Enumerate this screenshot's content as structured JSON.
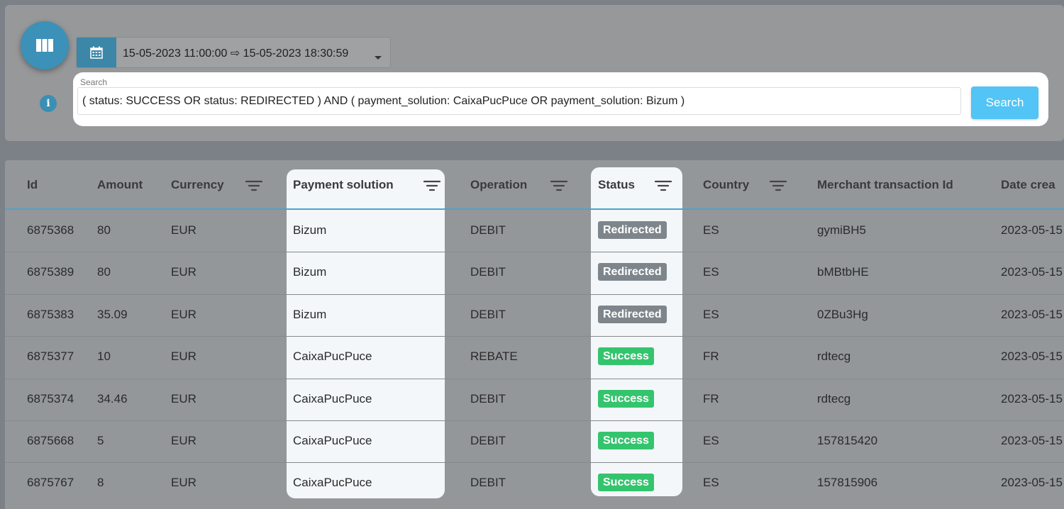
{
  "date_range": {
    "value": "15-05-2023 11:00:00 ⇨ 15-05-2023 18:30:59"
  },
  "search": {
    "label": "Search",
    "value": "( status: SUCCESS OR status: REDIRECTED ) AND ( payment_solution: CaixaPucPuce OR payment_solution: Bizum )",
    "button_label": "Search"
  },
  "icons": {
    "fab": "columns-icon",
    "calendar": "calendar-icon",
    "info": "info-icon",
    "info_glyph": "i",
    "filter": "filter-icon"
  },
  "colors": {
    "accent": "#3b91b8",
    "search_button": "#52c4f5",
    "badge_redirected": "#7e868c",
    "badge_success": "#34c46e",
    "header_line": "#4aa3cf"
  },
  "table": {
    "columns": [
      {
        "key": "id",
        "label": "Id",
        "filter": false
      },
      {
        "key": "amount",
        "label": "Amount",
        "filter": false
      },
      {
        "key": "currency",
        "label": "Currency",
        "filter": true
      },
      {
        "key": "payment_solution",
        "label": "Payment solution",
        "filter": true
      },
      {
        "key": "operation",
        "label": "Operation",
        "filter": true
      },
      {
        "key": "status",
        "label": "Status",
        "filter": true
      },
      {
        "key": "country",
        "label": "Country",
        "filter": true
      },
      {
        "key": "merchant_tx",
        "label": "Merchant transaction Id",
        "filter": false
      },
      {
        "key": "date",
        "label": "Date crea",
        "filter": false
      }
    ],
    "rows": [
      {
        "id": "6875368",
        "amount": "80",
        "currency": "EUR",
        "payment_solution": "Bizum",
        "operation": "DEBIT",
        "status": "Redirected",
        "status_type": "redirected",
        "country": "ES",
        "merchant_tx": "gymiBH5",
        "date": "2023-05-15"
      },
      {
        "id": "6875389",
        "amount": "80",
        "currency": "EUR",
        "payment_solution": "Bizum",
        "operation": "DEBIT",
        "status": "Redirected",
        "status_type": "redirected",
        "country": "ES",
        "merchant_tx": "bMBtbHE",
        "date": "2023-05-15"
      },
      {
        "id": "6875383",
        "amount": "35.09",
        "currency": "EUR",
        "payment_solution": "Bizum",
        "operation": "DEBIT",
        "status": "Redirected",
        "status_type": "redirected",
        "country": "ES",
        "merchant_tx": "0ZBu3Hg",
        "date": "2023-05-15"
      },
      {
        "id": "6875377",
        "amount": "10",
        "currency": "EUR",
        "payment_solution": "CaixaPucPuce",
        "operation": "REBATE",
        "status": "Success",
        "status_type": "success",
        "country": "FR",
        "merchant_tx": "rdtecg",
        "date": "2023-05-15"
      },
      {
        "id": "6875374",
        "amount": "34.46",
        "currency": "EUR",
        "payment_solution": "CaixaPucPuce",
        "operation": "DEBIT",
        "status": "Success",
        "status_type": "success",
        "country": "FR",
        "merchant_tx": "rdtecg",
        "date": "2023-05-15"
      },
      {
        "id": "6875668",
        "amount": "5",
        "currency": "EUR",
        "payment_solution": "CaixaPucPuce",
        "operation": "DEBIT",
        "status": "Success",
        "status_type": "success",
        "country": "ES",
        "merchant_tx": "157815420",
        "date": "2023-05-15"
      },
      {
        "id": "6875767",
        "amount": "8",
        "currency": "EUR",
        "payment_solution": "CaixaPucPuce",
        "operation": "DEBIT",
        "status": "Success",
        "status_type": "success",
        "country": "ES",
        "merchant_tx": "157815906",
        "date": "2023-05-15"
      }
    ]
  }
}
